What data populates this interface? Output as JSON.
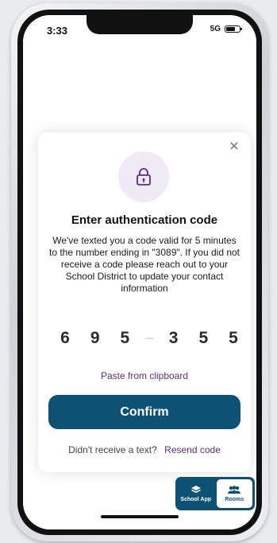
{
  "status_bar": {
    "time": "3:33",
    "network": "5G"
  },
  "modal": {
    "title": "Enter authentication code",
    "description": "We've texted you a code valid for 5 minutes to the number ending in \"3089\". If you did not receive a code please reach out to your School District to update your contact information",
    "code_digits": [
      "6",
      "9",
      "5",
      "3",
      "5",
      "5"
    ],
    "paste_label": "Paste from clipboard",
    "confirm_label": "Confirm",
    "resend_prompt": "Didn't receive a text?",
    "resend_label": "Resend code"
  },
  "switcher": {
    "tabs": [
      {
        "label": "School App",
        "icon": "layers-icon",
        "active": false
      },
      {
        "label": "Rooms",
        "icon": "people-icon",
        "active": true
      }
    ]
  },
  "colors": {
    "primary": "#0d5174",
    "link": "#5a2d82",
    "lock_badge": "#efeaf6"
  }
}
